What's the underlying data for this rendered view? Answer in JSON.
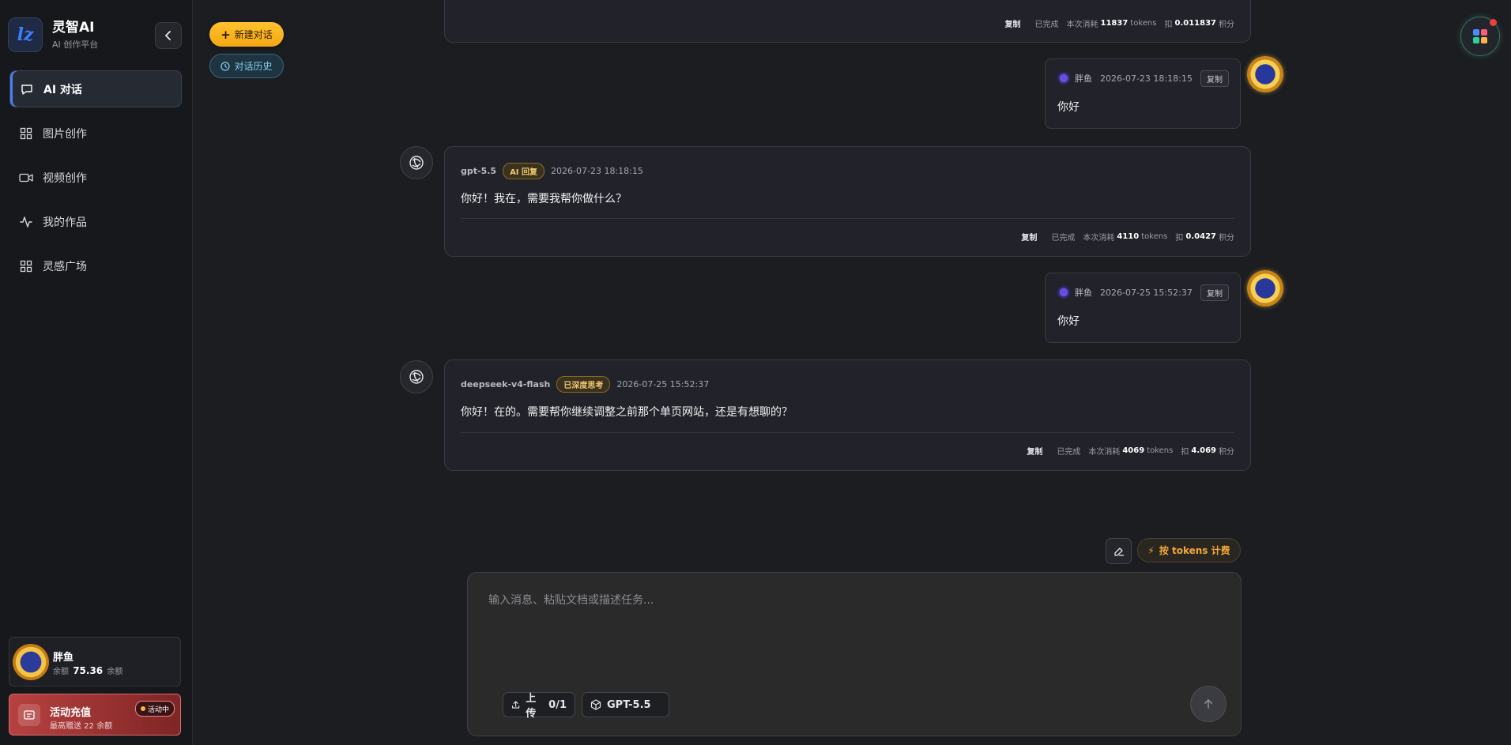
{
  "brand": {
    "title": "灵智AI",
    "subtitle": "AI 创作平台",
    "logo_text": "lz"
  },
  "nav": [
    {
      "label": "AI 对话",
      "icon": "chat-icon",
      "active": true
    },
    {
      "label": "图片创作",
      "icon": "grid-icon",
      "active": false
    },
    {
      "label": "视频创作",
      "icon": "video-icon",
      "active": false
    },
    {
      "label": "我的作品",
      "icon": "activity-icon",
      "active": false
    },
    {
      "label": "灵感广场",
      "icon": "grid-icon",
      "active": false
    }
  ],
  "user": {
    "name": "胖鱼",
    "balance_label": "余额",
    "balance": "75.36",
    "balance_unit": "余额"
  },
  "recharge": {
    "title": "活动充值",
    "subtitle": "最高赠送 22 余额",
    "badge": "活动中"
  },
  "top_buttons": {
    "new_chat": "新建对话",
    "history": "对话历史"
  },
  "messages": {
    "m0": {
      "copy": "复制",
      "status": "已完成",
      "usage_label": "本次消耗",
      "tokens": "11837",
      "tokens_unit": "tokens",
      "deduct_label": "扣",
      "points": "0.011837",
      "points_unit": "积分"
    },
    "u1": {
      "name": "胖鱼",
      "time": "2026-07-23 18:18:15",
      "copy": "复制",
      "text": "你好"
    },
    "a1": {
      "model": "gpt-5.5",
      "badge": "AI 回复",
      "time": "2026-07-23 18:18:15",
      "text": "你好！我在，需要我帮你做什么？",
      "copy": "复制",
      "status": "已完成",
      "usage_label": "本次消耗",
      "tokens": "4110",
      "tokens_unit": "tokens",
      "deduct_label": "扣",
      "points": "0.0427",
      "points_unit": "积分"
    },
    "u2": {
      "name": "胖鱼",
      "time": "2026-07-25 15:52:37",
      "copy": "复制",
      "text": "你好"
    },
    "a2": {
      "model": "deepseek-v4-flash",
      "badge": "已深度思考",
      "time": "2026-07-25 15:52:37",
      "text": "你好！在的。需要帮你继续调整之前那个单页网站，还是有想聊的？",
      "copy": "复制",
      "status": "已完成",
      "usage_label": "本次消耗",
      "tokens": "4069",
      "tokens_unit": "tokens",
      "deduct_label": "扣",
      "points": "4.069",
      "points_unit": "积分"
    }
  },
  "tools": {
    "billing": "按 tokens 计费"
  },
  "composer": {
    "placeholder": "输入消息、粘贴文档或描述任务...",
    "upload_label": "上传",
    "upload_count": "0/1",
    "model": "GPT-5.5"
  },
  "colors": {
    "accent_gold": "#f3a712",
    "accent_cyan": "#7fd3f2",
    "recharge_red": "#b84141",
    "active_blue": "#4c7ff0"
  }
}
